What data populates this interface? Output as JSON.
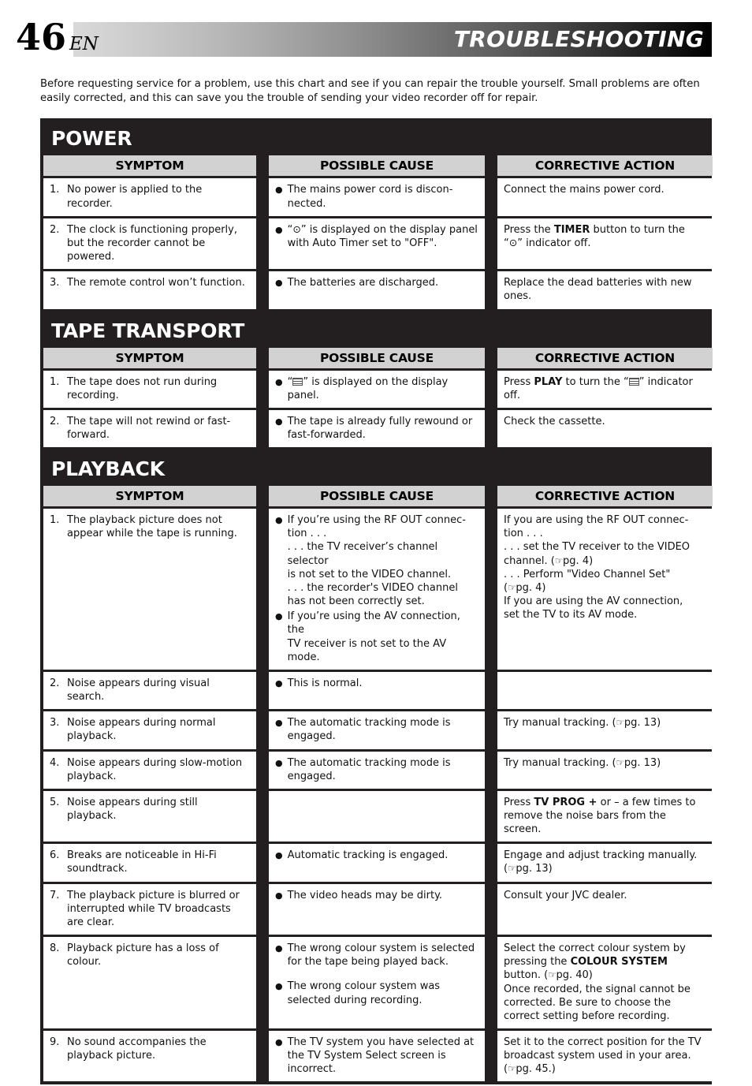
{
  "header": {
    "page_number": "46",
    "language_code": "EN",
    "title": "TROUBLESHOOTING"
  },
  "intro": "Before requesting service for a problem, use this chart and see if you can repair the trouble yourself. Small problems are often easily corrected, and this can save you the trouble of sending your video recorder off for repair.",
  "columns": {
    "symptom": "SYMPTOM",
    "possible_cause": "POSSIBLE CAUSE",
    "corrective_action": "CORRECTIVE ACTION"
  },
  "sections": [
    {
      "title": "POWER",
      "rows": [
        {
          "num": "1.",
          "symptom": "No power is applied to the recorder.",
          "causes": [
            "The mains power cord is discon-nected."
          ],
          "cause_lines_1": "The mains power cord is discon-",
          "cause_lines_2": "nected.",
          "action": "Connect the mains power cord."
        },
        {
          "num": "2.",
          "symptom": "The clock is functioning properly, but the recorder cannot be powered.",
          "cause_pre": "“",
          "cause_post": "” is displayed on the display panel with Auto Timer set to \"OFF\".",
          "action_pre": "Press the ",
          "action_bold": "TIMER",
          "action_mid": " button to turn the “",
          "action_post": "” indicator off."
        },
        {
          "num": "3.",
          "symptom": "The remote control won’t function.",
          "cause": "The batteries are discharged.",
          "action": "Replace the dead batteries with new ones."
        }
      ]
    },
    {
      "title": "TAPE TRANSPORT",
      "rows": [
        {
          "num": "1.",
          "symptom": "The tape does not run during recording.",
          "cause_pre": "“",
          "cause_post": "” is displayed on the display panel.",
          "action_pre": "Press ",
          "action_bold": "PLAY",
          "action_mid": " to turn the “",
          "action_post": "” indicator off."
        },
        {
          "num": "2.",
          "symptom": "The tape will not rewind or fast-forward.",
          "cause": "The tape is already fully rewound or fast-forwarded.",
          "action": "Check the cassette."
        }
      ]
    },
    {
      "title": "PLAYBACK",
      "rows": [
        {
          "num": "1.",
          "symptom": "The playback picture does not appear while the tape is running.",
          "cause_b1_l1": "If you’re using the RF OUT connec-",
          "cause_b1_l2": "tion . . .",
          "cause_b1_l3": ". . . the TV receiver’s channel selector",
          "cause_b1_l4": "is not set to the VIDEO channel.",
          "cause_b1_l5": ". . . the recorder's VIDEO channel",
          "cause_b1_l6": "has not been correctly set.",
          "cause_b2_l1": "If you’re using the AV connection, the",
          "cause_b2_l2": "TV receiver is not set to the AV mode.",
          "action_l1": "If you are using the RF OUT connec-",
          "action_l2": "tion . . .",
          "action_l3": ". . . set the TV receiver to the VIDEO",
          "action_l4_pre": "channel. (",
          "action_l4_post": "pg. 4)",
          "action_l5": ". . . Perform \"Video Channel Set\"",
          "action_l6_pre": "(",
          "action_l6_post": "pg. 4)",
          "action_l7": "If you are using the AV connection,",
          "action_l8": "set the TV to its AV mode."
        },
        {
          "num": "2.",
          "symptom": "Noise appears during visual search.",
          "cause": "This is normal.",
          "action": ""
        },
        {
          "num": "3.",
          "symptom": "Noise appears during normal playback.",
          "cause": "The automatic tracking mode is engaged.",
          "action_pre": "Try manual tracking. (",
          "action_post": "pg. 13)"
        },
        {
          "num": "4.",
          "symptom": "Noise appears during slow-motion playback.",
          "cause": "The automatic tracking mode is engaged.",
          "action_pre": "Try manual tracking. (",
          "action_post": "pg. 13)"
        },
        {
          "num": "5.",
          "symptom": "Noise appears during still playback.",
          "cause": "",
          "action_pre": "Press ",
          "action_bold": "TV PROG +",
          "action_mid": " or – a few times to remove the noise bars from the screen."
        },
        {
          "num": "6.",
          "symptom": "Breaks are noticeable in Hi-Fi soundtrack.",
          "cause": "Automatic tracking is engaged.",
          "action_l1": "Engage and adjust tracking manually.",
          "action_l2_pre": "(",
          "action_l2_post": "pg. 13)"
        },
        {
          "num": "7.",
          "symptom": "The playback picture is blurred or interrupted while TV broadcasts are clear.",
          "cause": "The video heads may be dirty.",
          "action": "Consult your JVC dealer."
        },
        {
          "num": "8.",
          "symptom": "Playback picture has a loss of colour.",
          "cause_1": "The wrong colour system is selected for the tape being played back.",
          "cause_2": "The wrong colour system was selected during recording.",
          "action_l1": "Select the correct colour system by",
          "action_l2_pre": "pressing the ",
          "action_l2_bold": "COLOUR SYSTEM",
          "action_l3_pre": "button. (",
          "action_l3_post": "pg. 40)",
          "action_l4": "Once recorded, the signal cannot be",
          "action_l5": "corrected. Be sure to choose the",
          "action_l6": "correct setting before recording."
        },
        {
          "num": "9.",
          "symptom": "No sound accompanies the playback picture.",
          "cause": "The TV system you have selected at the TV System Select screen is incorrect.",
          "action_l1": "Set it to the correct position for the TV",
          "action_l2": "broadcast system used in your area.",
          "action_l3_pre": "(",
          "action_l3_post": "pg. 45.)"
        }
      ]
    }
  ],
  "icons": {
    "clock": "⊙",
    "hand_pointer": "☞",
    "bullet": "●"
  }
}
